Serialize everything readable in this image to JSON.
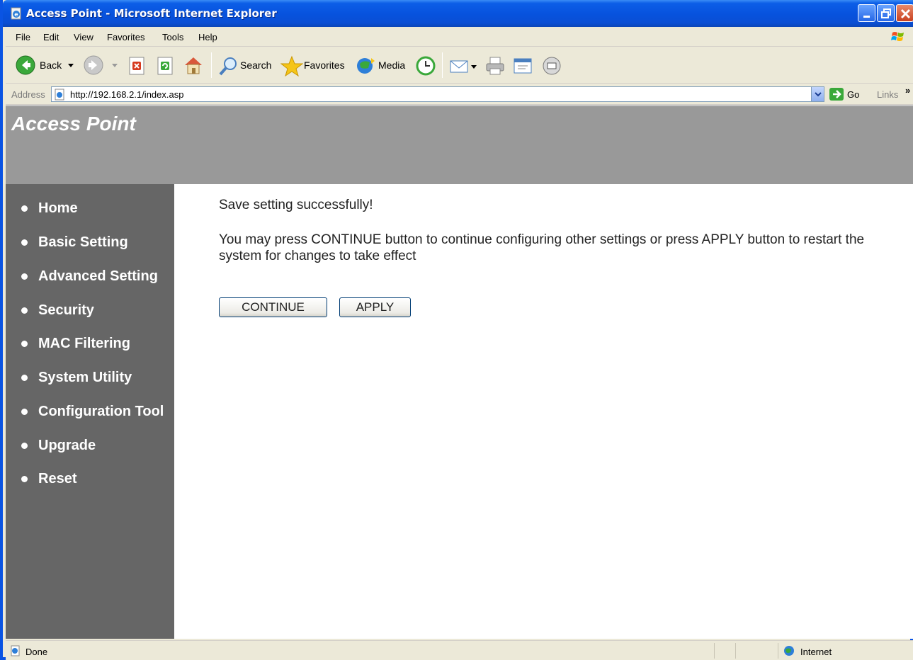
{
  "window": {
    "title": "Access Point - Microsoft Internet Explorer"
  },
  "menubar": {
    "items": [
      "File",
      "Edit",
      "View",
      "Favorites",
      "Tools",
      "Help"
    ]
  },
  "toolbar": {
    "back_label": "Back",
    "search_label": "Search",
    "favorites_label": "Favorites",
    "media_label": "Media"
  },
  "address": {
    "label": "Address",
    "url": "http://192.168.2.1/index.asp",
    "go_label": "Go",
    "links_label": "Links",
    "more": "»"
  },
  "banner": {
    "brand": "Access Point"
  },
  "sidebar": {
    "items": [
      {
        "label": "Home"
      },
      {
        "label": "Basic Setting"
      },
      {
        "label": "Advanced Setting"
      },
      {
        "label": "Security"
      },
      {
        "label": "MAC Filtering"
      },
      {
        "label": "System Utility"
      },
      {
        "label": "Configuration Tool"
      },
      {
        "label": "Upgrade"
      },
      {
        "label": "Reset"
      }
    ]
  },
  "main": {
    "headline": "Save setting successfully!",
    "message": "You may press CONTINUE button to continue configuring other settings or press APPLY button to restart the system for changes to take effect",
    "continue_label": "CONTINUE",
    "apply_label": "APPLY"
  },
  "status": {
    "text": "Done",
    "zone": "Internet"
  },
  "colors": {
    "banner": "#999999",
    "sidebar": "#666666",
    "titlebar": "#0752dd"
  }
}
